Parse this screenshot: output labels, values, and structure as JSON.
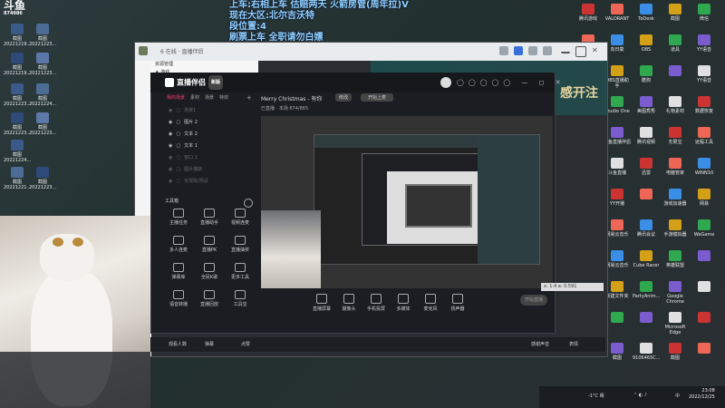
{
  "overlay": {
    "lines": [
      "上车:右相上车 估赔两天 火箭房管(周年拉)V",
      "现在大区:北尔吉沃特",
      "段位置:4",
      "刷票上车 全职请勿白嫖"
    ]
  },
  "desktop_left": [
    {
      "label": "截图",
      "sub": "20221219..."
    },
    {
      "label": "截图",
      "sub": "20221223..."
    },
    {
      "label": "截图",
      "sub": "20221219..."
    },
    {
      "label": "截图",
      "sub": "20221223..."
    },
    {
      "label": "截图",
      "sub": "20221223..."
    },
    {
      "label": "截图",
      "sub": "20221224..."
    },
    {
      "label": "截图",
      "sub": "20221223..."
    },
    {
      "label": "截图",
      "sub": "20221223..."
    },
    {
      "label": "截图",
      "sub": "20221224..."
    },
    {
      "label": "截图",
      "sub": "20221221..."
    },
    {
      "label": "截图",
      "sub": "20221223..."
    }
  ],
  "desktop_right": [
    [
      "腾讯游戏",
      "VALORANT",
      "ToDesk",
      "截图",
      "微信"
    ],
    [
      "Tank Takes",
      "向日葵",
      "OBS",
      "道具",
      "YY语音"
    ],
    [
      "Cotton Party",
      "OBS直播助手",
      "酷狗",
      "",
      "YY语音"
    ],
    [
      "剑灵一元",
      "Studio One",
      "美图秀秀",
      "礼物素材",
      "数据恢复"
    ],
    [
      "Human Fall",
      "斗鱼直播伴侣",
      "腾讯视频",
      "无限宝",
      "远程工具"
    ],
    [
      "PUBG BATTLEGR...",
      "斗鱼直播",
      "迅雷",
      "电脑管家",
      "WINN10"
    ],
    [
      "Draw & Guess",
      "YY开播",
      "",
      "游戏加速器",
      "网易"
    ],
    [
      "Goose Goose Duck",
      "网易云音乐",
      "腾讯会议",
      "手游模拟器",
      "WeGame"
    ],
    [
      "Goose Goose Duck",
      "网易云音乐",
      "Cube Racer",
      "英雄联盟",
      ""
    ],
    [
      "",
      "新建文件夹",
      "PartyAnim...",
      "Google Chrome",
      ""
    ],
    [
      "",
      "",
      "",
      "Microsoft Edge",
      ""
    ],
    [
      "",
      "截图",
      "9106465C...",
      "截图",
      ""
    ]
  ],
  "browser": {
    "title": "6 在线 · 直播伴侣",
    "banner_text": "感开注"
  },
  "tree_items": [
    "资源管理",
    "★ 游戏",
    "★ 休闲",
    "★ 娱乐",
    "小窝",
    "无双",
    "无双",
    "日常",
    "主页",
    "主页",
    "晒晒",
    "发现",
    "Janre",
    "新闻",
    "毛毛"
  ],
  "app": {
    "logo_text": "直播伴侣",
    "badge": "新版",
    "tabs": [
      "我的场景",
      "素材",
      "场景",
      "特效"
    ],
    "scenes": [
      {
        "name": "场景1",
        "dim": true
      },
      {
        "name": "图片 2",
        "dim": false
      },
      {
        "name": "文本 2",
        "dim": false
      },
      {
        "name": "文本 1",
        "dim": false
      },
      {
        "name": "窗口 1",
        "dim": true
      },
      {
        "name": "图片捕获",
        "dim": true
      },
      {
        "name": "无规则/预设",
        "dim": true
      }
    ],
    "tools_header": "工具箱",
    "tools": [
      [
        "主播任务",
        "直播助手",
        "视频连麦"
      ],
      [
        "多人连麦",
        "直播PK",
        "直播抽奖"
      ],
      [
        "弹幕库",
        "全民K歌",
        "更多工具"
      ],
      [
        "语音转播",
        "直播回放",
        "工具宝"
      ]
    ],
    "preview_title": "Merry Christmas - 有你",
    "preview_status": "已直播 · 本场 874/865",
    "preview_button": "开始上麦",
    "bottom_buttons": [
      "直播屏幕",
      "摄像头",
      "手机投屏",
      "多媒体",
      "麦克风",
      "扬声器"
    ],
    "start_label": "开始直播",
    "status_items": [
      "观看人数",
      "弹幕",
      "点赞",
      "感谢声音",
      "表情"
    ]
  },
  "taskbar": {
    "temp": "-1°C 晴",
    "lang": "中",
    "time": "23:08",
    "date": "2022/12/25"
  },
  "chip_text": "x: 1.4  a: 0.591"
}
